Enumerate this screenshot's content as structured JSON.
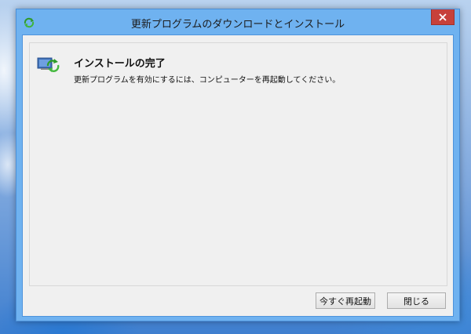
{
  "window": {
    "title": "更新プログラムのダウンロードとインストール"
  },
  "content": {
    "heading": "インストールの完了",
    "message": "更新プログラムを有効にするには、コンピューターを再起動してください。"
  },
  "buttons": {
    "restart_now": "今すぐ再起動",
    "close": "閉じる"
  },
  "icons": {
    "title": "windows-update-icon",
    "content": "update-install-icon",
    "close": "close-icon"
  },
  "colors": {
    "title_bar": "#6fb2f0",
    "close_button": "#c7413a",
    "client_background": "#f0f0f0"
  }
}
